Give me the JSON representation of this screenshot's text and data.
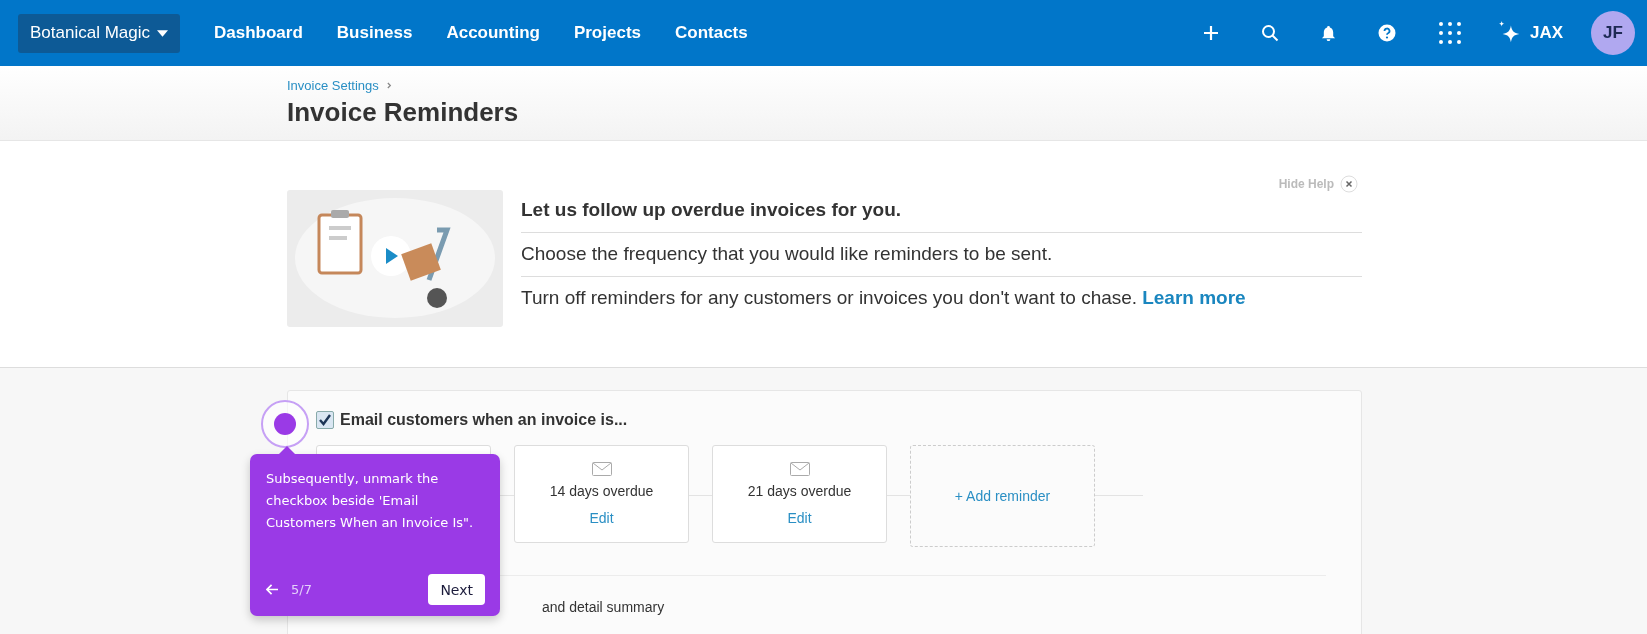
{
  "nav": {
    "org": "Botanical Magic",
    "links": [
      {
        "label": "Dashboard"
      },
      {
        "label": "Business"
      },
      {
        "label": "Accounting"
      },
      {
        "label": "Projects"
      },
      {
        "label": "Contacts"
      }
    ],
    "assistant": "JAX",
    "user_initials": "JF"
  },
  "header": {
    "breadcrumb": "Invoice Settings",
    "title": "Invoice Reminders"
  },
  "help": {
    "hide_label": "Hide Help",
    "heading": "Let us follow up overdue invoices for you.",
    "lines": [
      "Choose the frequency that you would like reminders to be sent.",
      "Turn off reminders for any customers or invoices you don't want to chase."
    ],
    "learn_more": "Learn more"
  },
  "reminders": {
    "checked": true,
    "label": "Email customers when an invoice is...",
    "items": [
      {
        "label": "14 days overdue",
        "action": "Edit"
      },
      {
        "label": "21 days overdue",
        "action": "Edit"
      }
    ],
    "add": "+ Add reminder",
    "include_summary": {
      "label": "and detail summary"
    }
  },
  "tour": {
    "text": "Subsequently, unmark the checkbox beside 'Email Customers When an Invoice Is\".",
    "step": "5/7",
    "next": "Next"
  }
}
